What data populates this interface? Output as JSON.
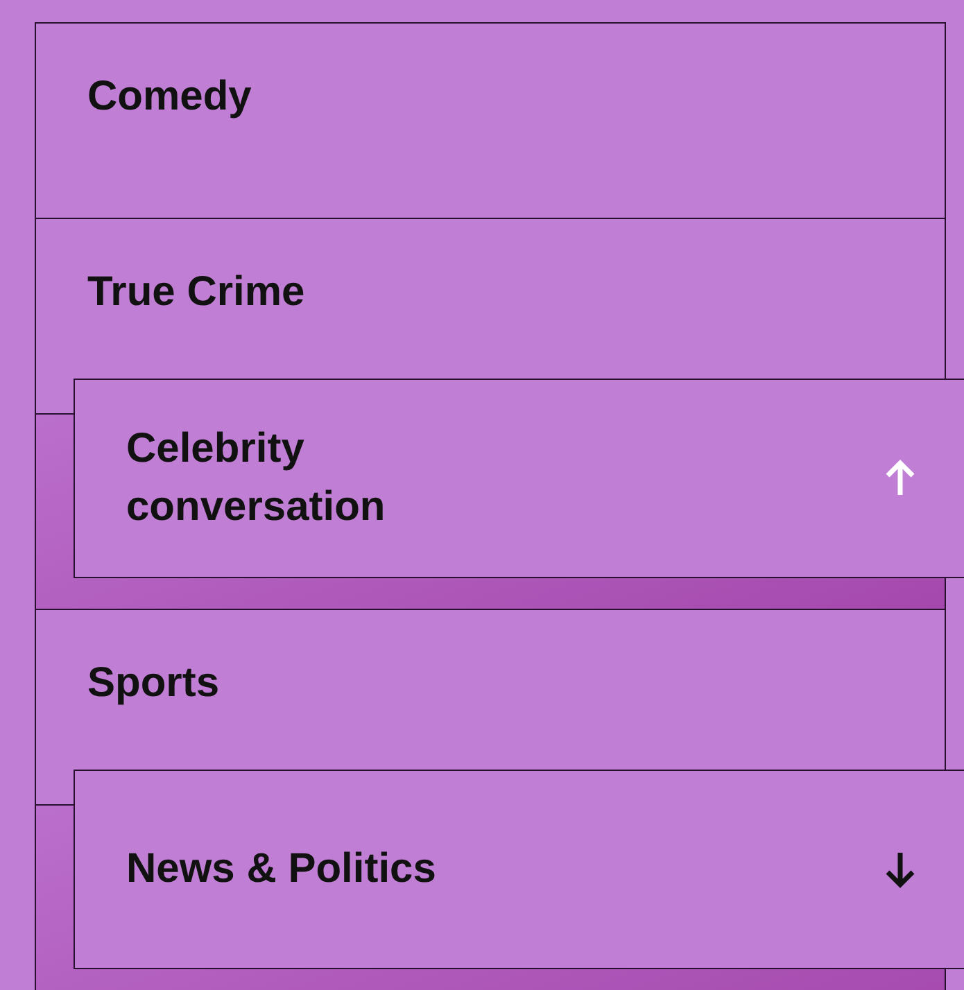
{
  "categories": [
    {
      "kind": "row",
      "label": "Comedy"
    },
    {
      "kind": "row",
      "label": "True Crime"
    },
    {
      "kind": "slot",
      "card": {
        "label": "Celebrity conversation",
        "kind": "up",
        "highlighted": true
      }
    },
    {
      "kind": "row",
      "label": "Sports"
    },
    {
      "kind": "slot",
      "card": {
        "label": "News & Politics",
        "kind": "down",
        "highlighted": false
      }
    }
  ]
}
